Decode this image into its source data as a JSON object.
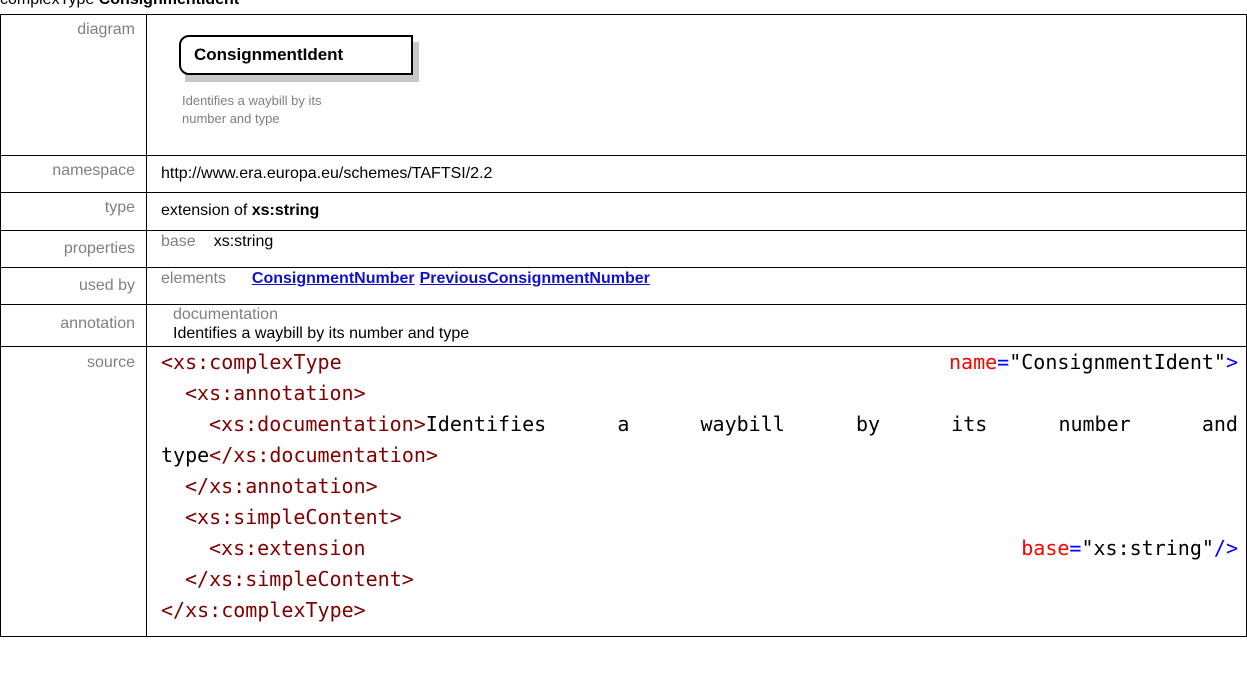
{
  "heading": {
    "prefix": "complexType",
    "name": "ConsignmentIdent"
  },
  "rows": {
    "diagram": {
      "label": "diagram",
      "box_title": "ConsignmentIdent",
      "doc_line1": "Identifies a waybill by its",
      "doc_line2": "number and type"
    },
    "namespace": {
      "label": "namespace",
      "value": "http://www.era.europa.eu/schemes/TAFTSI/2.2"
    },
    "type": {
      "label": "type",
      "prefix": "extension of",
      "value": "xs:string"
    },
    "properties": {
      "label": "properties",
      "key": "base",
      "value": "xs:string"
    },
    "used_by": {
      "label": "used by",
      "key": "elements",
      "links": [
        "ConsignmentNumber",
        "PreviousConsignmentNumber"
      ]
    },
    "annotation": {
      "label": "annotation",
      "key": "documentation",
      "value": "Identifies a waybill by its number and type"
    },
    "source": {
      "label": "source",
      "lines": {
        "l1_tag": "<xs:complexType",
        "l1_attr": "name",
        "l1_eq": "=",
        "l1_val": "\"ConsignmentIdent\"",
        "l1_close": ">",
        "l2": "<xs:annotation>",
        "l3_open": "<xs:documentation>",
        "l3_w1": "Identifies",
        "l3_w2": "a",
        "l3_w3": "waybill",
        "l3_w4": "by",
        "l3_w5": "its",
        "l3_w6": "number",
        "l3_w7": "and",
        "l4_text": "type",
        "l4_close": "</xs:documentation>",
        "l5": "</xs:annotation>",
        "l6": "<xs:simpleContent>",
        "l7_tag": "<xs:extension",
        "l7_attr": "base",
        "l7_eq": "=",
        "l7_val": "\"xs:string\"",
        "l7_close": "/>",
        "l8": "</xs:simpleContent>",
        "l9": "</xs:complexType>"
      }
    }
  }
}
